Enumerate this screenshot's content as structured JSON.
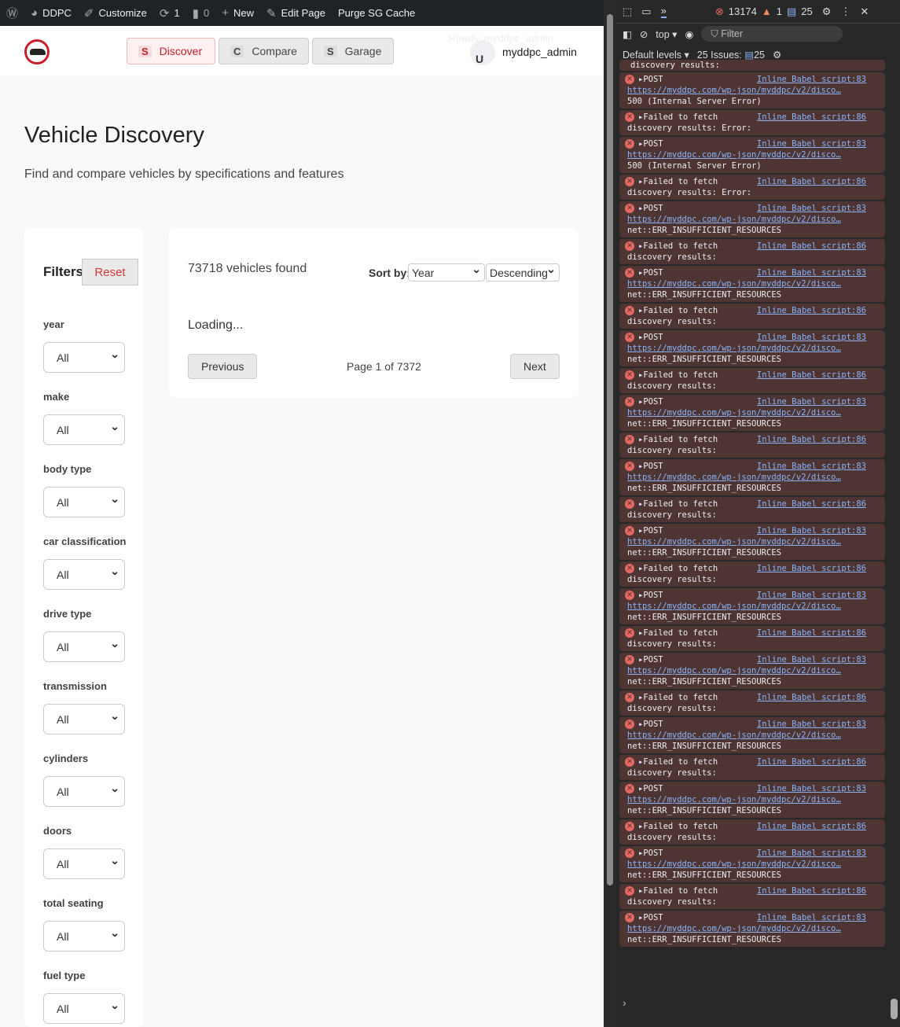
{
  "adminbar": {
    "site": "DDPC",
    "customize": "Customize",
    "updates": "1",
    "comments": "0",
    "new": "New",
    "edit": "Edit Page",
    "purge": "Purge SG Cache"
  },
  "header": {
    "nav": [
      {
        "letter": "S",
        "label": "Discover"
      },
      {
        "letter": "C",
        "label": "Compare"
      },
      {
        "letter": "S",
        "label": "Garage"
      }
    ],
    "howdy": "Howdy, myddpc_admin",
    "avatar_letter": "U",
    "username": "myddpc_admin"
  },
  "page": {
    "title": "Vehicle Discovery",
    "subtitle": "Find and compare vehicles by specifications and features"
  },
  "filters": {
    "title": "Filters",
    "reset": "Reset",
    "groups": [
      {
        "label": "year",
        "value": "All"
      },
      {
        "label": "make",
        "value": "All"
      },
      {
        "label": "body type",
        "value": "All"
      },
      {
        "label": "car classification",
        "value": "All"
      },
      {
        "label": "drive type",
        "value": "All"
      },
      {
        "label": "transmission",
        "value": "All"
      },
      {
        "label": "cylinders",
        "value": "All"
      },
      {
        "label": "doors",
        "value": "All"
      },
      {
        "label": "total seating",
        "value": "All"
      },
      {
        "label": "fuel type",
        "value": "All"
      }
    ]
  },
  "results": {
    "count": "73718 vehicles found",
    "sort_label": "Sort by:",
    "sort_field": "Year",
    "sort_order": "Descending",
    "loading": "Loading...",
    "prev": "Previous",
    "page_info": "Page 1 of 7372",
    "next": "Next"
  },
  "devtools": {
    "errors": "13174",
    "warnings": "1",
    "info": "25",
    "context": "top",
    "filter_placeholder": "Filter",
    "levels": "Default levels",
    "issues_label": "25 Issues:",
    "issues_count": "25",
    "top_partial": "discovery results:",
    "entries": [
      {
        "head": "POST",
        "src": "Inline Babel script:83",
        "url": "https://myddpc.com/wp-json/myddpc/v2/disco…",
        "msg": "500 (Internal Server Error)"
      },
      {
        "head": "Failed to fetch",
        "src": "Inline Babel script:86",
        "msg": "discovery results: Error:"
      },
      {
        "head": "POST",
        "src": "Inline Babel script:83",
        "url": "https://myddpc.com/wp-json/myddpc/v2/disco…",
        "msg": "500 (Internal Server Error)"
      },
      {
        "head": "Failed to fetch",
        "src": "Inline Babel script:86",
        "msg": "discovery results: Error:"
      },
      {
        "head": "POST",
        "src": "Inline Babel script:83",
        "url": "https://myddpc.com/wp-json/myddpc/v2/disco…",
        "msg": "net::ERR_INSUFFICIENT_RESOURCES"
      },
      {
        "head": "Failed to fetch",
        "src": "Inline Babel script:86",
        "msg": "discovery results:"
      },
      {
        "head": "POST",
        "src": "Inline Babel script:83",
        "url": "https://myddpc.com/wp-json/myddpc/v2/disco…",
        "msg": "net::ERR_INSUFFICIENT_RESOURCES"
      },
      {
        "head": "Failed to fetch",
        "src": "Inline Babel script:86",
        "msg": "discovery results:"
      },
      {
        "head": "POST",
        "src": "Inline Babel script:83",
        "url": "https://myddpc.com/wp-json/myddpc/v2/disco…",
        "msg": "net::ERR_INSUFFICIENT_RESOURCES"
      },
      {
        "head": "Failed to fetch",
        "src": "Inline Babel script:86",
        "msg": "discovery results:"
      },
      {
        "head": "POST",
        "src": "Inline Babel script:83",
        "url": "https://myddpc.com/wp-json/myddpc/v2/disco…",
        "msg": "net::ERR_INSUFFICIENT_RESOURCES"
      },
      {
        "head": "Failed to fetch",
        "src": "Inline Babel script:86",
        "msg": "discovery results:"
      },
      {
        "head": "POST",
        "src": "Inline Babel script:83",
        "url": "https://myddpc.com/wp-json/myddpc/v2/disco…",
        "msg": "net::ERR_INSUFFICIENT_RESOURCES"
      },
      {
        "head": "Failed to fetch",
        "src": "Inline Babel script:86",
        "msg": "discovery results:"
      },
      {
        "head": "POST",
        "src": "Inline Babel script:83",
        "url": "https://myddpc.com/wp-json/myddpc/v2/disco…",
        "msg": "net::ERR_INSUFFICIENT_RESOURCES"
      },
      {
        "head": "Failed to fetch",
        "src": "Inline Babel script:86",
        "msg": "discovery results:"
      },
      {
        "head": "POST",
        "src": "Inline Babel script:83",
        "url": "https://myddpc.com/wp-json/myddpc/v2/disco…",
        "msg": "net::ERR_INSUFFICIENT_RESOURCES"
      },
      {
        "head": "Failed to fetch",
        "src": "Inline Babel script:86",
        "msg": "discovery results:"
      },
      {
        "head": "POST",
        "src": "Inline Babel script:83",
        "url": "https://myddpc.com/wp-json/myddpc/v2/disco…",
        "msg": "net::ERR_INSUFFICIENT_RESOURCES"
      },
      {
        "head": "Failed to fetch",
        "src": "Inline Babel script:86",
        "msg": "discovery results:"
      },
      {
        "head": "POST",
        "src": "Inline Babel script:83",
        "url": "https://myddpc.com/wp-json/myddpc/v2/disco…",
        "msg": "net::ERR_INSUFFICIENT_RESOURCES"
      },
      {
        "head": "Failed to fetch",
        "src": "Inline Babel script:86",
        "msg": "discovery results:"
      },
      {
        "head": "POST",
        "src": "Inline Babel script:83",
        "url": "https://myddpc.com/wp-json/myddpc/v2/disco…",
        "msg": "net::ERR_INSUFFICIENT_RESOURCES"
      },
      {
        "head": "Failed to fetch",
        "src": "Inline Babel script:86",
        "msg": "discovery results:"
      },
      {
        "head": "POST",
        "src": "Inline Babel script:83",
        "url": "https://myddpc.com/wp-json/myddpc/v2/disco…",
        "msg": "net::ERR_INSUFFICIENT_RESOURCES"
      },
      {
        "head": "Failed to fetch",
        "src": "Inline Babel script:86",
        "msg": "discovery results:"
      },
      {
        "head": "POST",
        "src": "Inline Babel script:83",
        "url": "https://myddpc.com/wp-json/myddpc/v2/disco…",
        "msg": "net::ERR_INSUFFICIENT_RESOURCES"
      }
    ]
  }
}
